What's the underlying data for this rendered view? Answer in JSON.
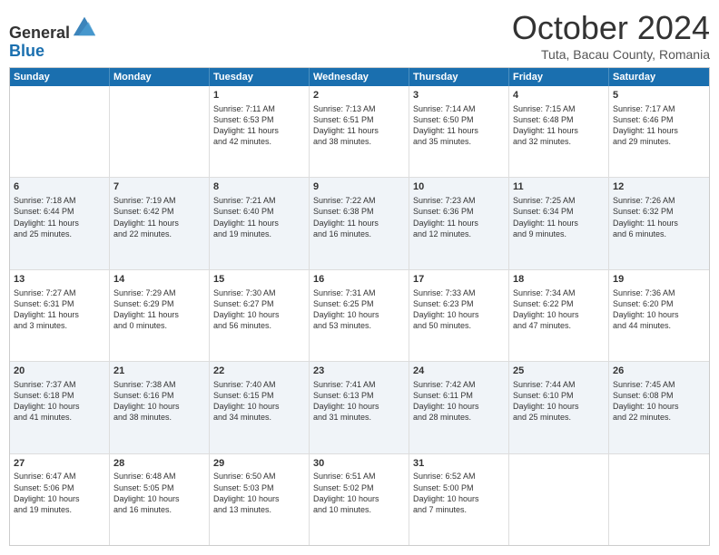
{
  "header": {
    "logo_general": "General",
    "logo_blue": "Blue",
    "month_title": "October 2024",
    "location": "Tuta, Bacau County, Romania"
  },
  "days_of_week": [
    "Sunday",
    "Monday",
    "Tuesday",
    "Wednesday",
    "Thursday",
    "Friday",
    "Saturday"
  ],
  "rows": [
    {
      "alt": false,
      "cells": [
        {
          "day": "",
          "lines": []
        },
        {
          "day": "",
          "lines": []
        },
        {
          "day": "1",
          "lines": [
            "Sunrise: 7:11 AM",
            "Sunset: 6:53 PM",
            "Daylight: 11 hours",
            "and 42 minutes."
          ]
        },
        {
          "day": "2",
          "lines": [
            "Sunrise: 7:13 AM",
            "Sunset: 6:51 PM",
            "Daylight: 11 hours",
            "and 38 minutes."
          ]
        },
        {
          "day": "3",
          "lines": [
            "Sunrise: 7:14 AM",
            "Sunset: 6:50 PM",
            "Daylight: 11 hours",
            "and 35 minutes."
          ]
        },
        {
          "day": "4",
          "lines": [
            "Sunrise: 7:15 AM",
            "Sunset: 6:48 PM",
            "Daylight: 11 hours",
            "and 32 minutes."
          ]
        },
        {
          "day": "5",
          "lines": [
            "Sunrise: 7:17 AM",
            "Sunset: 6:46 PM",
            "Daylight: 11 hours",
            "and 29 minutes."
          ]
        }
      ]
    },
    {
      "alt": true,
      "cells": [
        {
          "day": "6",
          "lines": [
            "Sunrise: 7:18 AM",
            "Sunset: 6:44 PM",
            "Daylight: 11 hours",
            "and 25 minutes."
          ]
        },
        {
          "day": "7",
          "lines": [
            "Sunrise: 7:19 AM",
            "Sunset: 6:42 PM",
            "Daylight: 11 hours",
            "and 22 minutes."
          ]
        },
        {
          "day": "8",
          "lines": [
            "Sunrise: 7:21 AM",
            "Sunset: 6:40 PM",
            "Daylight: 11 hours",
            "and 19 minutes."
          ]
        },
        {
          "day": "9",
          "lines": [
            "Sunrise: 7:22 AM",
            "Sunset: 6:38 PM",
            "Daylight: 11 hours",
            "and 16 minutes."
          ]
        },
        {
          "day": "10",
          "lines": [
            "Sunrise: 7:23 AM",
            "Sunset: 6:36 PM",
            "Daylight: 11 hours",
            "and 12 minutes."
          ]
        },
        {
          "day": "11",
          "lines": [
            "Sunrise: 7:25 AM",
            "Sunset: 6:34 PM",
            "Daylight: 11 hours",
            "and 9 minutes."
          ]
        },
        {
          "day": "12",
          "lines": [
            "Sunrise: 7:26 AM",
            "Sunset: 6:32 PM",
            "Daylight: 11 hours",
            "and 6 minutes."
          ]
        }
      ]
    },
    {
      "alt": false,
      "cells": [
        {
          "day": "13",
          "lines": [
            "Sunrise: 7:27 AM",
            "Sunset: 6:31 PM",
            "Daylight: 11 hours",
            "and 3 minutes."
          ]
        },
        {
          "day": "14",
          "lines": [
            "Sunrise: 7:29 AM",
            "Sunset: 6:29 PM",
            "Daylight: 11 hours",
            "and 0 minutes."
          ]
        },
        {
          "day": "15",
          "lines": [
            "Sunrise: 7:30 AM",
            "Sunset: 6:27 PM",
            "Daylight: 10 hours",
            "and 56 minutes."
          ]
        },
        {
          "day": "16",
          "lines": [
            "Sunrise: 7:31 AM",
            "Sunset: 6:25 PM",
            "Daylight: 10 hours",
            "and 53 minutes."
          ]
        },
        {
          "day": "17",
          "lines": [
            "Sunrise: 7:33 AM",
            "Sunset: 6:23 PM",
            "Daylight: 10 hours",
            "and 50 minutes."
          ]
        },
        {
          "day": "18",
          "lines": [
            "Sunrise: 7:34 AM",
            "Sunset: 6:22 PM",
            "Daylight: 10 hours",
            "and 47 minutes."
          ]
        },
        {
          "day": "19",
          "lines": [
            "Sunrise: 7:36 AM",
            "Sunset: 6:20 PM",
            "Daylight: 10 hours",
            "and 44 minutes."
          ]
        }
      ]
    },
    {
      "alt": true,
      "cells": [
        {
          "day": "20",
          "lines": [
            "Sunrise: 7:37 AM",
            "Sunset: 6:18 PM",
            "Daylight: 10 hours",
            "and 41 minutes."
          ]
        },
        {
          "day": "21",
          "lines": [
            "Sunrise: 7:38 AM",
            "Sunset: 6:16 PM",
            "Daylight: 10 hours",
            "and 38 minutes."
          ]
        },
        {
          "day": "22",
          "lines": [
            "Sunrise: 7:40 AM",
            "Sunset: 6:15 PM",
            "Daylight: 10 hours",
            "and 34 minutes."
          ]
        },
        {
          "day": "23",
          "lines": [
            "Sunrise: 7:41 AM",
            "Sunset: 6:13 PM",
            "Daylight: 10 hours",
            "and 31 minutes."
          ]
        },
        {
          "day": "24",
          "lines": [
            "Sunrise: 7:42 AM",
            "Sunset: 6:11 PM",
            "Daylight: 10 hours",
            "and 28 minutes."
          ]
        },
        {
          "day": "25",
          "lines": [
            "Sunrise: 7:44 AM",
            "Sunset: 6:10 PM",
            "Daylight: 10 hours",
            "and 25 minutes."
          ]
        },
        {
          "day": "26",
          "lines": [
            "Sunrise: 7:45 AM",
            "Sunset: 6:08 PM",
            "Daylight: 10 hours",
            "and 22 minutes."
          ]
        }
      ]
    },
    {
      "alt": false,
      "cells": [
        {
          "day": "27",
          "lines": [
            "Sunrise: 6:47 AM",
            "Sunset: 5:06 PM",
            "Daylight: 10 hours",
            "and 19 minutes."
          ]
        },
        {
          "day": "28",
          "lines": [
            "Sunrise: 6:48 AM",
            "Sunset: 5:05 PM",
            "Daylight: 10 hours",
            "and 16 minutes."
          ]
        },
        {
          "day": "29",
          "lines": [
            "Sunrise: 6:50 AM",
            "Sunset: 5:03 PM",
            "Daylight: 10 hours",
            "and 13 minutes."
          ]
        },
        {
          "day": "30",
          "lines": [
            "Sunrise: 6:51 AM",
            "Sunset: 5:02 PM",
            "Daylight: 10 hours",
            "and 10 minutes."
          ]
        },
        {
          "day": "31",
          "lines": [
            "Sunrise: 6:52 AM",
            "Sunset: 5:00 PM",
            "Daylight: 10 hours",
            "and 7 minutes."
          ]
        },
        {
          "day": "",
          "lines": []
        },
        {
          "day": "",
          "lines": []
        }
      ]
    }
  ]
}
